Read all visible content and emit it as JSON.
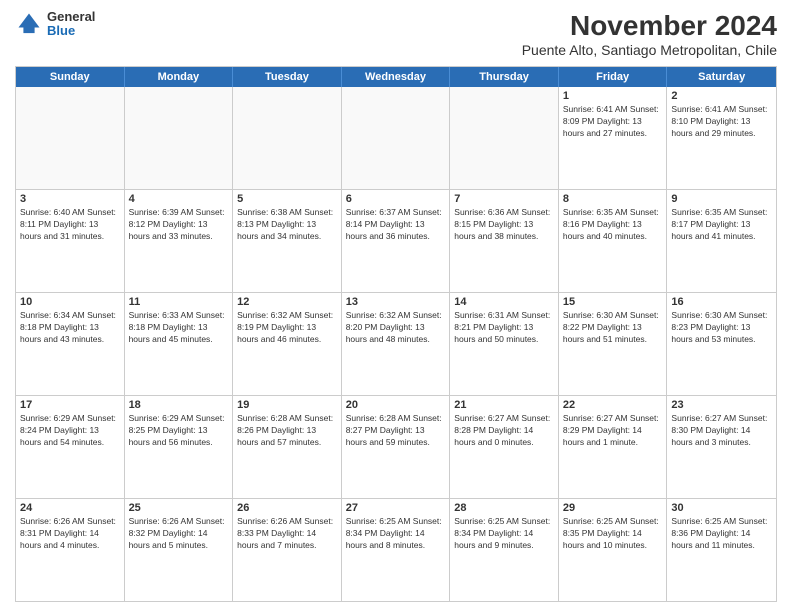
{
  "header": {
    "title": "November 2024",
    "subtitle": "Puente Alto, Santiago Metropolitan, Chile",
    "logo": {
      "general": "General",
      "blue": "Blue"
    }
  },
  "calendar": {
    "days": [
      "Sunday",
      "Monday",
      "Tuesday",
      "Wednesday",
      "Thursday",
      "Friday",
      "Saturday"
    ],
    "rows": [
      [
        {
          "day": "",
          "info": ""
        },
        {
          "day": "",
          "info": ""
        },
        {
          "day": "",
          "info": ""
        },
        {
          "day": "",
          "info": ""
        },
        {
          "day": "",
          "info": ""
        },
        {
          "day": "1",
          "info": "Sunrise: 6:41 AM\nSunset: 8:09 PM\nDaylight: 13 hours\nand 27 minutes."
        },
        {
          "day": "2",
          "info": "Sunrise: 6:41 AM\nSunset: 8:10 PM\nDaylight: 13 hours\nand 29 minutes."
        }
      ],
      [
        {
          "day": "3",
          "info": "Sunrise: 6:40 AM\nSunset: 8:11 PM\nDaylight: 13 hours\nand 31 minutes."
        },
        {
          "day": "4",
          "info": "Sunrise: 6:39 AM\nSunset: 8:12 PM\nDaylight: 13 hours\nand 33 minutes."
        },
        {
          "day": "5",
          "info": "Sunrise: 6:38 AM\nSunset: 8:13 PM\nDaylight: 13 hours\nand 34 minutes."
        },
        {
          "day": "6",
          "info": "Sunrise: 6:37 AM\nSunset: 8:14 PM\nDaylight: 13 hours\nand 36 minutes."
        },
        {
          "day": "7",
          "info": "Sunrise: 6:36 AM\nSunset: 8:15 PM\nDaylight: 13 hours\nand 38 minutes."
        },
        {
          "day": "8",
          "info": "Sunrise: 6:35 AM\nSunset: 8:16 PM\nDaylight: 13 hours\nand 40 minutes."
        },
        {
          "day": "9",
          "info": "Sunrise: 6:35 AM\nSunset: 8:17 PM\nDaylight: 13 hours\nand 41 minutes."
        }
      ],
      [
        {
          "day": "10",
          "info": "Sunrise: 6:34 AM\nSunset: 8:18 PM\nDaylight: 13 hours\nand 43 minutes."
        },
        {
          "day": "11",
          "info": "Sunrise: 6:33 AM\nSunset: 8:18 PM\nDaylight: 13 hours\nand 45 minutes."
        },
        {
          "day": "12",
          "info": "Sunrise: 6:32 AM\nSunset: 8:19 PM\nDaylight: 13 hours\nand 46 minutes."
        },
        {
          "day": "13",
          "info": "Sunrise: 6:32 AM\nSunset: 8:20 PM\nDaylight: 13 hours\nand 48 minutes."
        },
        {
          "day": "14",
          "info": "Sunrise: 6:31 AM\nSunset: 8:21 PM\nDaylight: 13 hours\nand 50 minutes."
        },
        {
          "day": "15",
          "info": "Sunrise: 6:30 AM\nSunset: 8:22 PM\nDaylight: 13 hours\nand 51 minutes."
        },
        {
          "day": "16",
          "info": "Sunrise: 6:30 AM\nSunset: 8:23 PM\nDaylight: 13 hours\nand 53 minutes."
        }
      ],
      [
        {
          "day": "17",
          "info": "Sunrise: 6:29 AM\nSunset: 8:24 PM\nDaylight: 13 hours\nand 54 minutes."
        },
        {
          "day": "18",
          "info": "Sunrise: 6:29 AM\nSunset: 8:25 PM\nDaylight: 13 hours\nand 56 minutes."
        },
        {
          "day": "19",
          "info": "Sunrise: 6:28 AM\nSunset: 8:26 PM\nDaylight: 13 hours\nand 57 minutes."
        },
        {
          "day": "20",
          "info": "Sunrise: 6:28 AM\nSunset: 8:27 PM\nDaylight: 13 hours\nand 59 minutes."
        },
        {
          "day": "21",
          "info": "Sunrise: 6:27 AM\nSunset: 8:28 PM\nDaylight: 14 hours\nand 0 minutes."
        },
        {
          "day": "22",
          "info": "Sunrise: 6:27 AM\nSunset: 8:29 PM\nDaylight: 14 hours\nand 1 minute."
        },
        {
          "day": "23",
          "info": "Sunrise: 6:27 AM\nSunset: 8:30 PM\nDaylight: 14 hours\nand 3 minutes."
        }
      ],
      [
        {
          "day": "24",
          "info": "Sunrise: 6:26 AM\nSunset: 8:31 PM\nDaylight: 14 hours\nand 4 minutes."
        },
        {
          "day": "25",
          "info": "Sunrise: 6:26 AM\nSunset: 8:32 PM\nDaylight: 14 hours\nand 5 minutes."
        },
        {
          "day": "26",
          "info": "Sunrise: 6:26 AM\nSunset: 8:33 PM\nDaylight: 14 hours\nand 7 minutes."
        },
        {
          "day": "27",
          "info": "Sunrise: 6:25 AM\nSunset: 8:34 PM\nDaylight: 14 hours\nand 8 minutes."
        },
        {
          "day": "28",
          "info": "Sunrise: 6:25 AM\nSunset: 8:34 PM\nDaylight: 14 hours\nand 9 minutes."
        },
        {
          "day": "29",
          "info": "Sunrise: 6:25 AM\nSunset: 8:35 PM\nDaylight: 14 hours\nand 10 minutes."
        },
        {
          "day": "30",
          "info": "Sunrise: 6:25 AM\nSunset: 8:36 PM\nDaylight: 14 hours\nand 11 minutes."
        }
      ]
    ]
  }
}
